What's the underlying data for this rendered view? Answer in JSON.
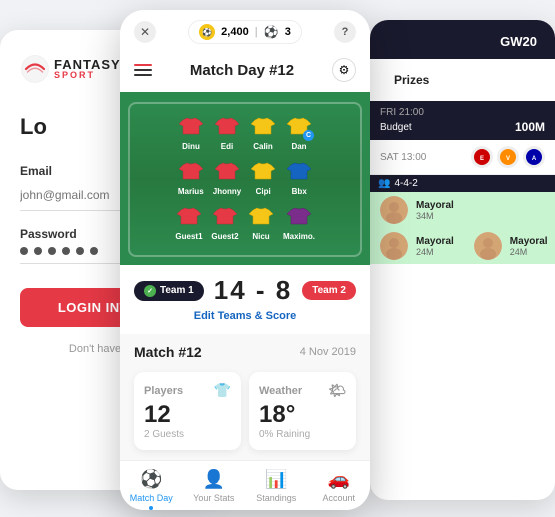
{
  "login": {
    "logo_text": "FANTASY",
    "logo_sub": "SPORT",
    "title": "Lo",
    "email_label": "Email",
    "email_placeholder": "john@gmail.com",
    "password_label": "Password",
    "login_btn": "LOGIN INTO YO",
    "footer_text": "Don't have an ac"
  },
  "stats_right": {
    "gw_label": "GW20",
    "prizes_btn": "Prizes",
    "match1_time": "FRI 21:00",
    "budget_label": "Budget",
    "budget_val": "100M",
    "match2_time": "SAT 13:00",
    "formation": "4-4-2",
    "player1_name": "Mayoral",
    "player1_val": "34M",
    "player2_name": "Mayoral",
    "player2_val": "24M",
    "player3_name": "Mayoral",
    "player3_val": "24M"
  },
  "phone": {
    "coin_amount": "2,400",
    "coin_count": "3",
    "match_day_title": "Match Day #12",
    "score_left": "14",
    "score_separator": "-",
    "score_right": "8",
    "team1_label": "Team 1",
    "team2_label": "Team 2",
    "edit_teams": "Edit Teams & Score",
    "match_number": "Match #12",
    "match_date": "4 Nov 2019",
    "players_label": "Players",
    "players_count": "12",
    "players_sub": "2 Guests",
    "weather_label": "Weather",
    "weather_val": "18",
    "weather_unit": "°",
    "weather_sub": "0% Raining",
    "nav": [
      {
        "label": "Match Day",
        "active": true
      },
      {
        "label": "Your Stats",
        "active": false
      },
      {
        "label": "Standings",
        "active": false
      },
      {
        "label": "Account",
        "active": false
      }
    ],
    "players": [
      {
        "name": "Calin",
        "row": 1,
        "shirt": "yellow"
      },
      {
        "name": "Dan",
        "row": 1,
        "shirt": "yellow"
      },
      {
        "name": "Dinu",
        "row": 1,
        "shirt": "red"
      },
      {
        "name": "Edi",
        "row": 1,
        "shirt": "red"
      },
      {
        "name": "Cipi",
        "row": 2,
        "shirt": "yellow"
      },
      {
        "name": "Bbx",
        "row": 2,
        "shirt": "blue"
      },
      {
        "name": "Marius",
        "row": 2,
        "shirt": "red"
      },
      {
        "name": "Jhonny",
        "row": 2,
        "shirt": "red"
      },
      {
        "name": "Nicu",
        "row": 3,
        "shirt": "yellow"
      },
      {
        "name": "Maximo.",
        "row": 3,
        "shirt": "purple"
      },
      {
        "name": "Guest1",
        "row": 3,
        "shirt": "red"
      },
      {
        "name": "Guest2",
        "row": 3,
        "shirt": "red"
      }
    ]
  }
}
